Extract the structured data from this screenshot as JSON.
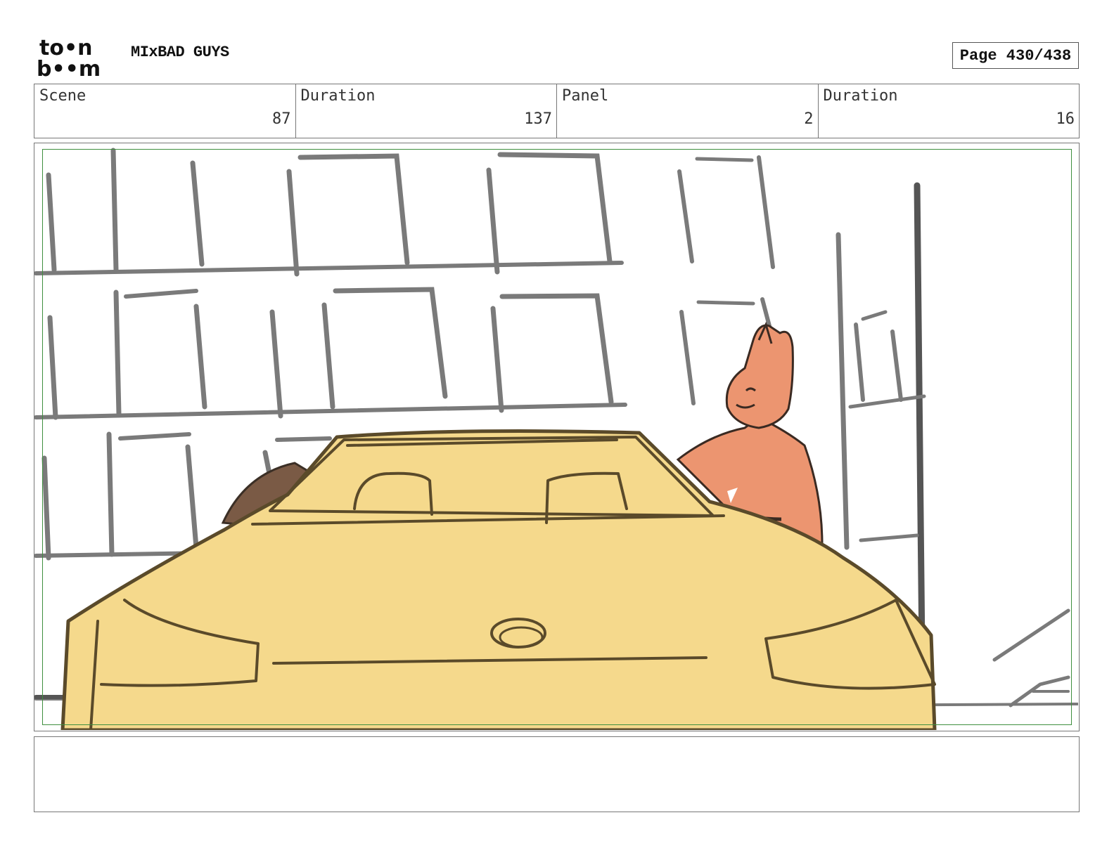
{
  "header": {
    "logo_top": "to•n",
    "logo_bottom": "b••m",
    "project_title": "MIxBAD GUYS",
    "page_label": "Page 430/438"
  },
  "info": {
    "scene_label": "Scene",
    "scene_value": "87",
    "scene_duration_label": "Duration",
    "scene_duration_value": "137",
    "panel_label": "Panel",
    "panel_value": "2",
    "panel_duration_label": "Duration",
    "panel_duration_value": "16"
  },
  "notes": {
    "text": ""
  },
  "colors": {
    "car": "#f5d98c",
    "character": "#ec9570",
    "building_lines": "#7a7a7a",
    "safe_area": "#3f8f3f"
  }
}
